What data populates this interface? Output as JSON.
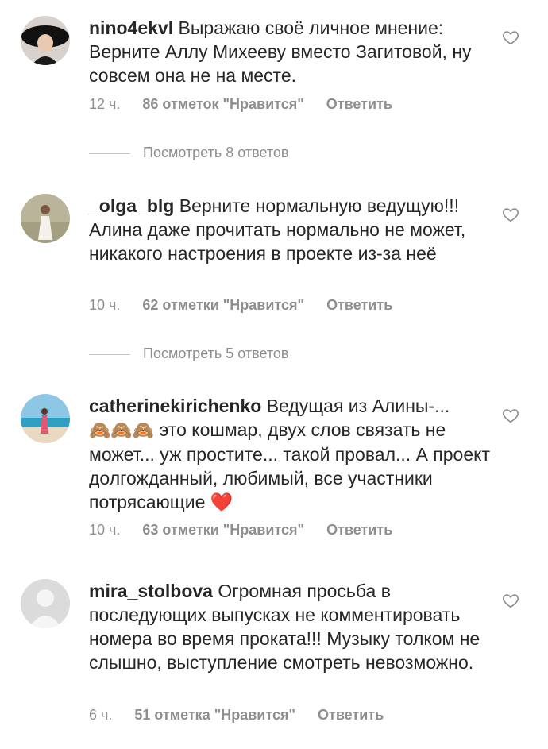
{
  "comments": [
    {
      "username": "nino4ekvl",
      "text": " Выражаю своё личное мнение: Верните Аллу Михееву  вместо Загитовой, ну совсем она не на месте.",
      "time": "12 ч.",
      "likes": "86 отметок \"Нравится\"",
      "reply": "Ответить",
      "view_replies": "Посмотреть 8 ответов"
    },
    {
      "username": "_olga_blg",
      "text": " Верните нормальную ведущую!!! Алина даже прочитать нормально не может, никакого настроения в проекте из-за неё",
      "time": "10 ч.",
      "likes": "62 отметки \"Нравится\"",
      "reply": "Ответить",
      "view_replies": "Посмотреть 5 ответов"
    },
    {
      "username": "catherinekirichenko",
      "text": " Ведущая из Алины-... ",
      "emoji": "🙈🙈🙈",
      "text2": " это кошмар, двух слов связать не может... уж простите... такой провал... А проект долгожданный, любимый, все участники потрясающие ",
      "heart_emoji": "❤️",
      "time": "10 ч.",
      "likes": "63 отметки \"Нравится\"",
      "reply": "Ответить"
    },
    {
      "username": "mira_stolbova",
      "text": " Огромная просьба в последующих выпусках не комментировать номера во время проката!!! Музыку толком не слышно, выступление смотреть невозможно.",
      "time": "6 ч.",
      "likes": "51 отметка \"Нравится\"",
      "reply": "Ответить"
    }
  ],
  "icons": {
    "like": "heart-outline-icon",
    "avatar_placeholder": "default-avatar-icon"
  },
  "colors": {
    "text": "#262626",
    "secondary": "#8e8e8e",
    "divider": "#c7c7c7",
    "heart": "#e0245e"
  }
}
